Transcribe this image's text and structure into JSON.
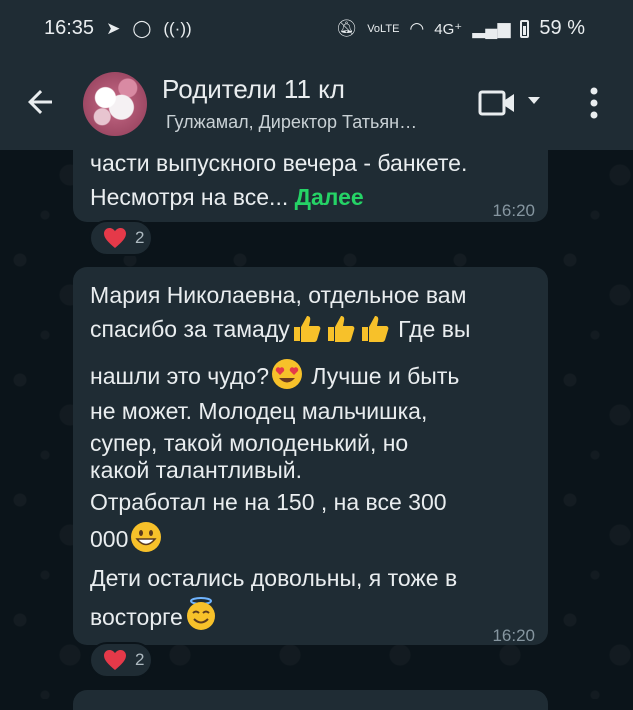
{
  "status_bar": {
    "time": "16:35",
    "network": "4G⁺",
    "battery": "59 %"
  },
  "header": {
    "title": "Родители 11 кл",
    "subtitle": "Гулжамал, Директор Татьян…"
  },
  "messages": [
    {
      "lines": [
        "части выпускного вечера - банкете."
      ],
      "last_line": "Несмотря на все...",
      "read_more": "Далее",
      "time": "16:20",
      "reaction_count": "2"
    },
    {
      "line1": "Мария Николаевна, отдельное вам",
      "line2": "спасибо за тамаду",
      "line2b": " Где вы",
      "line3": "нашли это чудо?",
      "line3b": " Лучше и быть",
      "line4": "не может. Молодец мальчишка,",
      "line5": "супер,  такой молоденький, но",
      "line6": "какой талантливый.",
      "line7": "Отработал не на 150 , на все 300",
      "line8": "000",
      "line9": "Дети остались довольны, я тоже в",
      "line10": "восторге",
      "time": "16:20",
      "reaction_count": "2"
    }
  ],
  "icons": [
    "back-arrow-icon",
    "video-call-icon",
    "chevron-down-icon",
    "more-vert-icon",
    "heart-icon",
    "thumbs-up-icon",
    "heart-eyes-emoji-icon",
    "grinning-emoji-icon",
    "halo-emoji-icon"
  ],
  "colors": {
    "bubble": "#1f2c34",
    "accent": "#25d366",
    "background": "#0b141a"
  }
}
